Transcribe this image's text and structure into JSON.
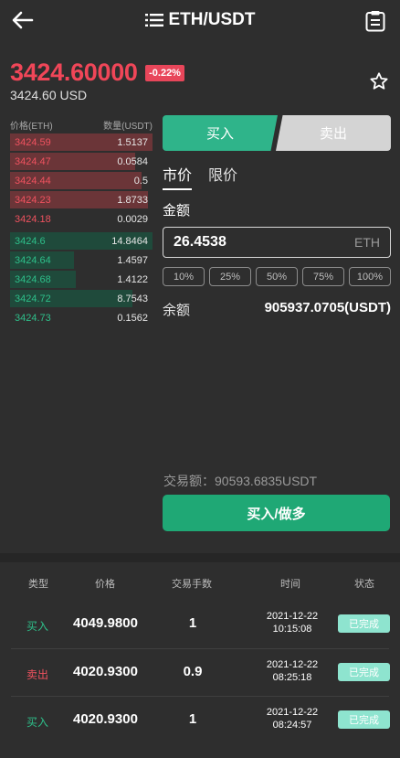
{
  "header": {
    "title": "ETH/USDT"
  },
  "ticker": {
    "price": "3424.60000",
    "change": "-0.22%",
    "usd": "3424.60 USD"
  },
  "orderbook": {
    "head_price": "价格(ETH)",
    "head_qty": "数量(USDT)",
    "asks": [
      {
        "price": "3424.59",
        "qty": "1.5137",
        "depth": 1.0
      },
      {
        "price": "3424.47",
        "qty": "0.0584",
        "depth": 0.88
      },
      {
        "price": "3424.44",
        "qty": "0.5",
        "depth": 0.92
      },
      {
        "price": "3424.23",
        "qty": "1.8733",
        "depth": 0.97
      },
      {
        "price": "3424.18",
        "qty": "0.0029",
        "depth": 0.0
      }
    ],
    "bids": [
      {
        "price": "3424.6",
        "qty": "14.8464",
        "depth": 1.0
      },
      {
        "price": "3424.64",
        "qty": "1.4597",
        "depth": 0.45
      },
      {
        "price": "3424.68",
        "qty": "1.4122",
        "depth": 0.46
      },
      {
        "price": "3424.72",
        "qty": "8.7543",
        "depth": 0.86
      },
      {
        "price": "3424.73",
        "qty": "0.1562",
        "depth": 0.0
      }
    ]
  },
  "trade": {
    "buy_tab": "买入",
    "sell_tab": "卖出",
    "market": "市价",
    "limit": "限价",
    "amount_label": "金额",
    "amount_value": "26.4538",
    "amount_unit": "ETH",
    "percents": [
      "10%",
      "25%",
      "50%",
      "75%",
      "100%"
    ],
    "balance_label": "余额",
    "balance_value": "905937.0705(USDT)",
    "fee_text": "交易额：90593.6835USDT",
    "action_label": "买入/做多"
  },
  "history": {
    "headers": {
      "type": "类型",
      "price": "价格",
      "qty": "交易手数",
      "time": "时间",
      "status": "状态"
    },
    "rows": [
      {
        "type": "买入",
        "side": "buy",
        "price": "4049.9800",
        "qty": "1",
        "date": "2021-12-22",
        "time": "10:15:08",
        "status": "已完成"
      },
      {
        "type": "卖出",
        "side": "sell",
        "price": "4020.9300",
        "qty": "0.9",
        "date": "2021-12-22",
        "time": "08:25:18",
        "status": "已完成"
      },
      {
        "type": "买入",
        "side": "buy",
        "price": "4020.9300",
        "qty": "1",
        "date": "2021-12-22",
        "time": "08:24:57",
        "status": "已完成"
      }
    ]
  },
  "colors": {
    "up": "#2ebf8a",
    "down": "#f0525f",
    "accent": "#1fa875"
  },
  "icons": {
    "back": "arrow-left-icon",
    "menu": "list-icon",
    "orders": "clipboard-icon",
    "favorite": "star-icon"
  }
}
